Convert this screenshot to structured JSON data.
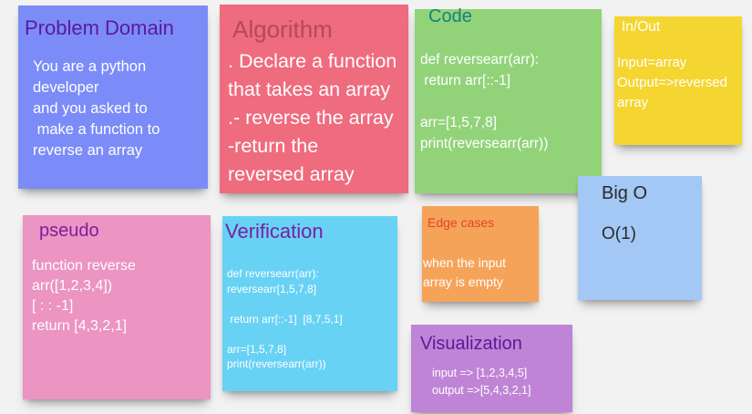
{
  "notes": {
    "problem": {
      "title": "Problem Domain",
      "lines": [
        "You are a python",
        "developer",
        "and you asked to",
        " make a function to",
        "reverse an array"
      ]
    },
    "algorithm": {
      "title": "Algorithm",
      "lines": [
        ". Declare a function",
        "that takes an array",
        ".- reverse the array",
        "-return the",
        "reversed array"
      ]
    },
    "code": {
      "title": "Code",
      "lines": [
        "def reversearr(arr):",
        " return arr[::-1]",
        "",
        "arr=[1,5,7,8]",
        "print(reversearr(arr))"
      ]
    },
    "inout": {
      "title": "In/Out",
      "lines": [
        "Input=array",
        "Output=>reversed",
        "array"
      ]
    },
    "bigo": {
      "title": "Big O",
      "lines": [
        "O(1)"
      ]
    },
    "pseudo": {
      "title": "pseudo",
      "lines": [
        "function reverse",
        "arr([1,2,3,4])",
        "[ : : -1]",
        "return [4,3,2,1]"
      ]
    },
    "verification": {
      "title": "Verification",
      "lines": [
        "def reversearr(arr):",
        "reversearr[1,5,7,8]",
        "",
        " return arr[::-1]  [8,7,5,1]",
        "",
        "arr=[1,5,7,8]",
        "print(reversearr(arr))"
      ]
    },
    "edge": {
      "title": "Edge cases",
      "lines": [
        "when the input",
        "array is empty"
      ]
    },
    "visualization": {
      "title": "Visualization",
      "lines": [
        "input => [1,2,3,4,5]",
        "output =>[5,4,3,2,1]"
      ]
    }
  },
  "colors": {
    "problem": "#7b8cf8",
    "algorithm": "#ef6b7e",
    "code": "#92d37a",
    "inout": "#f5d530",
    "bigo": "#a3c8f5",
    "pseudo": "#ec94c2",
    "verification": "#68d2f5",
    "edge": "#f6a35a",
    "visualization": "#c084d6"
  }
}
